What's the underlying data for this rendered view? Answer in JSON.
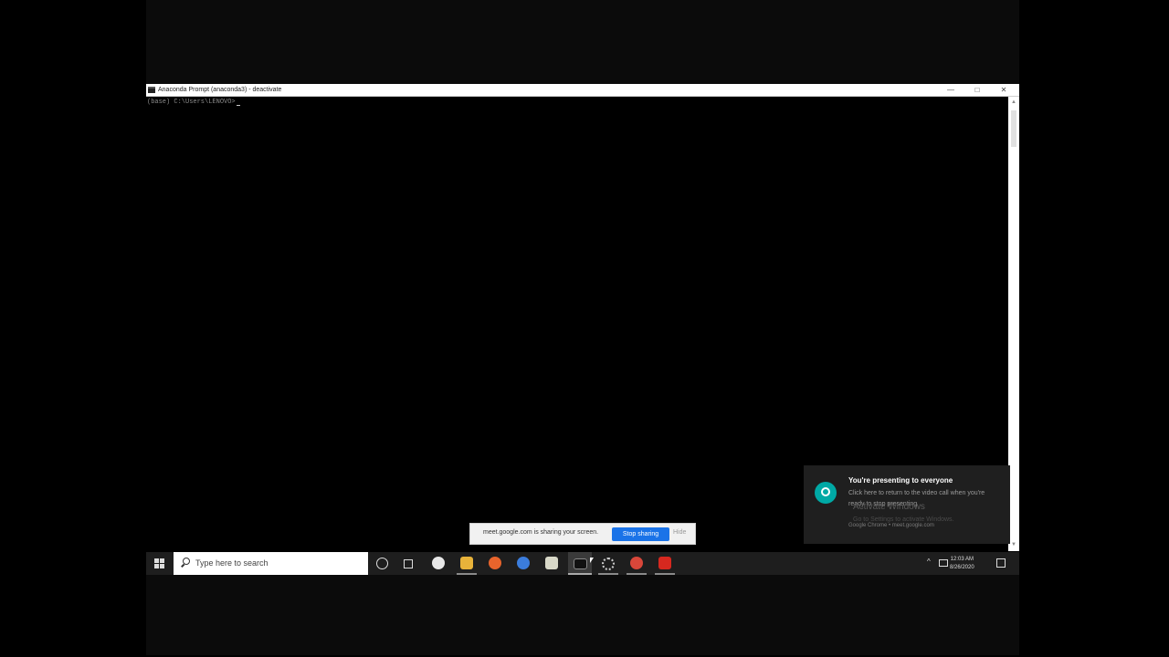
{
  "window": {
    "title": "Anaconda Prompt (anaconda3) - deactivate",
    "controls": {
      "minimize": "—",
      "maximize": "□",
      "close": "✕"
    }
  },
  "terminal": {
    "prompt": "(base) C:\\Users\\LENOVO>"
  },
  "share_bar": {
    "text": "meet.google.com is sharing your screen.",
    "stop_label": "Stop sharing",
    "hide_label": "Hide"
  },
  "toast": {
    "title": "You're presenting to everyone",
    "body": "Click here to return to the video call when you're ready to stop presenting",
    "source": "Google Chrome • meet.google.com",
    "watermark_1": "Activate Windows",
    "watermark_2": "Go to Settings to activate Windows.",
    "icon": "google-meet-icon",
    "accent": "#00a9a5"
  },
  "taskbar": {
    "search_placeholder": "Type here to search",
    "clock_time": "12:03 AM",
    "clock_date": "8/26/2020",
    "tray_chevron": "^",
    "icons": [
      "cortana-icon",
      "task-view-icon",
      "itunes-icon",
      "file-explorer-icon",
      "firefox-icon",
      "chrome-canary-icon",
      "app-icon",
      "anaconda-prompt-icon",
      "settings-icon",
      "chrome-icon",
      "acrobat-icon"
    ]
  },
  "colors": {
    "stop_button": "#1a73e8",
    "taskbar": "#1e1e1e"
  }
}
